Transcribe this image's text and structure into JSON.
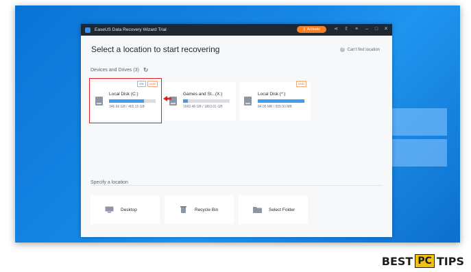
{
  "window": {
    "title": "EaseUS Data Recovery Wizard Trial",
    "activate_label": "Activate",
    "main_title": "Select a location to start recovering",
    "cant_find": "Can't find location"
  },
  "devices": {
    "section_label": "Devices and Drives (3)",
    "drives": [
      {
        "name": "Local Disk (C:)",
        "size": "346.66 GB / 465.15 GB",
        "usage_fraction": 0.745,
        "badges": [
          "OS",
          "SSD"
        ]
      },
      {
        "name": "Games and St...(X:)",
        "size": "1660.48 GB / 1863.01 GB",
        "usage_fraction": 0.11,
        "badges": []
      },
      {
        "name": "Local Disk (*:)",
        "size": "84.05 MB / 505.00 MB",
        "usage_fraction": 1.0,
        "badges": [
          "SSD"
        ]
      }
    ]
  },
  "locations": {
    "section_label": "Specify a location",
    "items": [
      {
        "label": "Desktop",
        "icon": "desktop-icon"
      },
      {
        "label": "Recycle Bin",
        "icon": "recycle-bin-icon"
      },
      {
        "label": "Select Folder",
        "icon": "folder-icon"
      }
    ]
  },
  "watermark": {
    "best": "BEST",
    "pc": "PC",
    "tips": "TIPS"
  },
  "colors": {
    "accent": "#3e9df0",
    "activate": "#f5802a",
    "highlight": "#e02020",
    "titlebar": "#1f2733"
  }
}
